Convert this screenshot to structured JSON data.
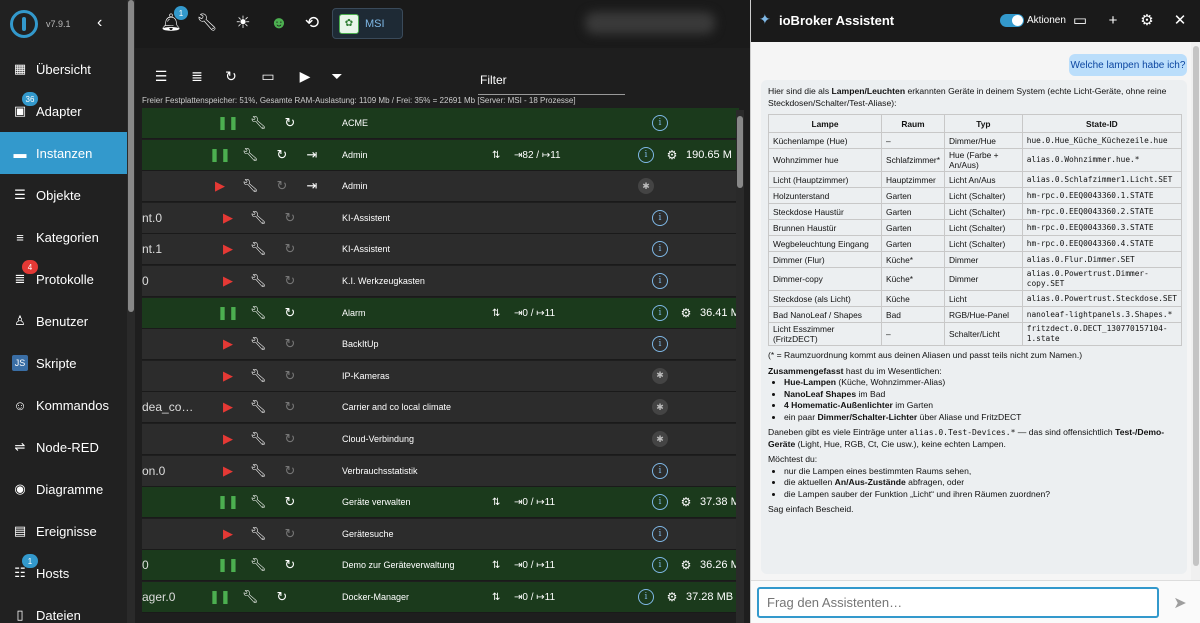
{
  "sidebar": {
    "version": "v7.9.1",
    "items": [
      {
        "label": "Übersicht",
        "icon": "apps-grid-icon",
        "glyph": "▦"
      },
      {
        "label": "Adapter",
        "icon": "store-icon",
        "glyph": "▣",
        "badge": "36"
      },
      {
        "label": "Instanzen",
        "icon": "instances-icon",
        "glyph": "▬"
      },
      {
        "label": "Objekte",
        "icon": "list-icon",
        "glyph": "☰"
      },
      {
        "label": "Kategorien",
        "icon": "categories-icon",
        "glyph": "≡"
      },
      {
        "label": "Protokolle",
        "icon": "log-icon",
        "glyph": "≣",
        "badge": "4"
      },
      {
        "label": "Benutzer",
        "icon": "user-icon",
        "glyph": "♙"
      },
      {
        "label": "Skripte",
        "icon": "javascript-icon",
        "glyph": "JS"
      },
      {
        "label": "Kommandos",
        "icon": "robot-icon",
        "glyph": "☺"
      },
      {
        "label": "Node-RED",
        "icon": "node-red-icon",
        "glyph": "⇌"
      },
      {
        "label": "Diagramme",
        "icon": "echarts-icon",
        "glyph": "◉"
      },
      {
        "label": "Ereignisse",
        "icon": "events-icon",
        "glyph": "▤"
      },
      {
        "label": "Hosts",
        "icon": "hosts-icon",
        "glyph": "☷",
        "badge": "1"
      },
      {
        "label": "Dateien",
        "icon": "files-icon",
        "glyph": "▯"
      }
    ]
  },
  "topbar": {
    "notifications_badge": "1",
    "host": "MSI"
  },
  "toolbar": {
    "filter_label": "Filter"
  },
  "memory_info": "Freier Festplattenspeicher: 51%, Gesamte RAM-Auslastung: 1109 Mb / Frei: 35% = 22691 Mb [Server: MSI - 18 Prozesse]",
  "instances": [
    {
      "id": "",
      "title": "ACME",
      "status": "pause",
      "reload": "on",
      "conn": "",
      "info": "info",
      "mem": ""
    },
    {
      "id": "",
      "title": "Admin",
      "status": "pause",
      "reload": "on",
      "conn": "⇥82 / ↦11",
      "info": "info",
      "mem": "190.65 M",
      "login": true
    },
    {
      "id": "",
      "title": "Admin",
      "status": "play",
      "reload": "dim",
      "conn": "",
      "info": "bug",
      "mem": "",
      "login": true
    },
    {
      "id": "nt.0",
      "title": "KI-Assistent",
      "status": "play",
      "reload": "dim",
      "conn": "",
      "info": "info",
      "mem": ""
    },
    {
      "id": "nt.1",
      "title": "KI-Assistent",
      "status": "play",
      "reload": "dim",
      "conn": "",
      "info": "info",
      "mem": ""
    },
    {
      "id": "0",
      "title": "K.I. Werkzeugkasten",
      "status": "play",
      "reload": "dim",
      "conn": "",
      "info": "info",
      "mem": ""
    },
    {
      "id": "",
      "title": "Alarm",
      "status": "pause",
      "reload": "on",
      "conn": "⇥0 / ↦11",
      "info": "info",
      "mem": "36.41 M"
    },
    {
      "id": "",
      "title": "BackItUp",
      "status": "play",
      "reload": "dim",
      "conn": "",
      "info": "info",
      "mem": ""
    },
    {
      "id": "",
      "title": "IP-Kameras",
      "status": "play",
      "reload": "dim",
      "conn": "",
      "info": "bug",
      "mem": ""
    },
    {
      "id": "dea_co…",
      "title": "Carrier and co local climate",
      "status": "play",
      "reload": "dim",
      "conn": "",
      "info": "bug",
      "mem": ""
    },
    {
      "id": "",
      "title": "Cloud-Verbindung",
      "status": "play",
      "reload": "dim",
      "conn": "",
      "info": "bug",
      "mem": ""
    },
    {
      "id": "on.0",
      "title": "Verbrauchsstatistik",
      "status": "play",
      "reload": "dim",
      "conn": "",
      "info": "info",
      "mem": ""
    },
    {
      "id": "",
      "title": "Geräte verwalten",
      "status": "pause",
      "reload": "on",
      "conn": "⇥0 / ↦11",
      "info": "info",
      "mem": "37.38 M"
    },
    {
      "id": "",
      "title": "Gerätesuche",
      "status": "play",
      "reload": "dim",
      "conn": "",
      "info": "info",
      "mem": ""
    },
    {
      "id": "0",
      "title": "Demo zur Geräteverwaltung",
      "status": "pause",
      "reload": "on",
      "conn": "⇥0 / ↦11",
      "info": "info",
      "mem": "36.26 M"
    },
    {
      "id": "ager.0",
      "title": "Docker-Manager",
      "status": "pause",
      "reload": "on",
      "conn": "⇥0 / ↦11",
      "info": "info",
      "mem": "37.28 MB"
    }
  ],
  "assistant": {
    "title": "ioBroker Assistent",
    "toggle_label": "Aktionen",
    "user_message": "Welche lampen habe ich?",
    "intro_pre": "Hier sind die als ",
    "intro_bold": "Lampen/Leuchten",
    "intro_post": " erkannten Geräte in deinem System (echte Licht-Geräte, ohne reine Steckdosen/Schalter/Test-Aliase):",
    "table_headers": [
      "Lampe",
      "Raum",
      "Typ",
      "State-ID"
    ],
    "table_rows": [
      [
        "Küchenlampe (Hue)",
        "–",
        "Dimmer/Hue",
        "hue.0.Hue_Küche_Küchezeile.hue"
      ],
      [
        "Wohnzimmer hue",
        "Schlafzimmer*",
        "Hue (Farbe + An/Aus)",
        "alias.0.Wohnzimmer.hue.*"
      ],
      [
        "Licht (Hauptzimmer)",
        "Hauptzimmer",
        "Licht An/Aus",
        "alias.0.Schlafzimmer1.Licht.SET"
      ],
      [
        "Holzunterstand",
        "Garten",
        "Licht (Schalter)",
        "hm-rpc.0.EEQ0043360.1.STATE"
      ],
      [
        "Steckdose Haustür",
        "Garten",
        "Licht (Schalter)",
        "hm-rpc.0.EEQ0043360.2.STATE"
      ],
      [
        "Brunnen Haustür",
        "Garten",
        "Licht (Schalter)",
        "hm-rpc.0.EEQ0043360.3.STATE"
      ],
      [
        "Wegbeleuchtung Eingang",
        "Garten",
        "Licht (Schalter)",
        "hm-rpc.0.EEQ0043360.4.STATE"
      ],
      [
        "Dimmer (Flur)",
        "Küche*",
        "Dimmer",
        "alias.0.Flur.Dimmer.SET"
      ],
      [
        "Dimmer-copy",
        "Küche*",
        "Dimmer",
        "alias.0.Powertrust.Dimmer-copy.SET"
      ],
      [
        "Steckdose (als Licht)",
        "Küche",
        "Licht",
        "alias.0.Powertrust.Steckdose.SET"
      ],
      [
        "Bad NanoLeaf / Shapes",
        "Bad",
        "RGB/Hue-Panel",
        "nanoleaf-lightpanels.3.Shapes.*"
      ],
      [
        "Licht Esszimmer (FritzDECT)",
        "–",
        "Schalter/Licht",
        "fritzdect.0.DECT_130770157104-1.state"
      ]
    ],
    "footnote": "(* = Raumzuordnung kommt aus deinen Aliasen und passt teils nicht zum Namen.)",
    "summary_bold": "Zusammengefasst",
    "summary_post": " hast du im Wesentlichen:",
    "bullets": [
      {
        "b": "Hue-Lampen",
        "t": " (Küche, Wohnzimmer-Alias)"
      },
      {
        "b": "NanoLeaf Shapes",
        "t": " im Bad"
      },
      {
        "b": "4 Homematic-Außenlichter",
        "t": " im Garten"
      },
      {
        "pre": "ein paar ",
        "b": "Dimmer/Schalter-Lichter",
        "t": " über Aliase und FritzDECT"
      }
    ],
    "extra_pre": "Daneben gibt es viele Einträge unter ",
    "extra_code": "alias.0.Test-Devices.*",
    "extra_mid": " — das sind offensichtlich ",
    "extra_bold": "Test-/Demo-Geräte",
    "extra_post": " (Light, Hue, RGB, Ct, Cie usw.), keine echten Lampen.",
    "question": "Möchtest du:",
    "options": [
      {
        "pre": "nur die Lampen eines bestimmten Raums sehen,",
        "b": "",
        "t": ""
      },
      {
        "pre": "die aktuellen ",
        "b": "An/Aus-Zustände",
        "t": " abfragen, oder"
      },
      {
        "pre": "die Lampen sauber der Funktion „Licht“ und ihren Räumen zuordnen?",
        "b": "",
        "t": ""
      }
    ],
    "closing": "Sag einfach Bescheid.",
    "input_placeholder": "Frag den Assistenten…"
  }
}
